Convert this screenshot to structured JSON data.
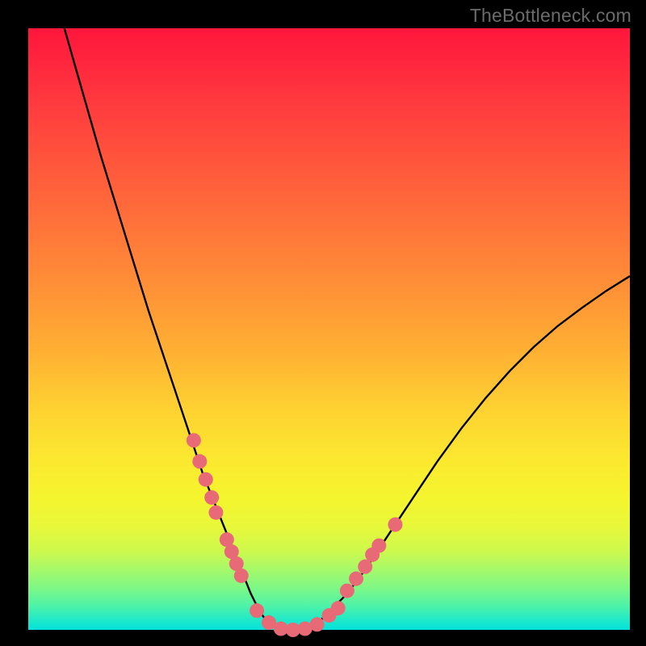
{
  "watermark": "TheBottleneck.com",
  "colors": {
    "curve_stroke": "#000000",
    "dot_fill": "#e76a76",
    "dot_stroke": "#c95560",
    "frame_bg": "#000000"
  },
  "chart_data": {
    "type": "line",
    "title": "",
    "xlabel": "",
    "ylabel": "",
    "xlim": [
      0,
      100
    ],
    "ylim": [
      0,
      100
    ],
    "grid": false,
    "series": [
      {
        "name": "bottleneck-curve",
        "x": [
          6,
          8,
          10,
          12,
          14,
          16,
          18,
          20,
          22,
          24,
          26,
          27,
          28,
          29,
          30,
          31,
          32,
          33,
          34,
          35,
          36,
          37,
          38,
          39,
          40,
          42,
          44,
          46,
          48,
          50,
          53,
          56,
          60,
          64,
          68,
          72,
          76,
          80,
          84,
          88,
          92,
          96,
          100
        ],
        "y": [
          100,
          93,
          86,
          79,
          72.5,
          66,
          59.5,
          53,
          47,
          41,
          35,
          32,
          29,
          26,
          23.5,
          21,
          18.5,
          16,
          13.5,
          11,
          8.5,
          6,
          4,
          2.3,
          1,
          0.1,
          0.0,
          0.2,
          1,
          3,
          6,
          10,
          16,
          22,
          28,
          33.5,
          38.5,
          43,
          47,
          50.5,
          53.5,
          56.3,
          58.8
        ]
      }
    ],
    "dots": {
      "name": "highlighted-points",
      "left_cluster_x": [
        27.5,
        28.5,
        29.5,
        30.5,
        31.2,
        33.0,
        33.8,
        34.6,
        35.4
      ],
      "left_cluster_y": [
        31.5,
        28.0,
        25.0,
        22.0,
        19.5,
        15.0,
        13.0,
        11.0,
        9.0
      ],
      "valley_x": [
        38.0,
        40.0,
        42.0,
        44.0,
        46.0,
        48.0,
        50.0,
        51.5
      ],
      "valley_y": [
        3.2,
        1.2,
        0.2,
        0.0,
        0.2,
        0.9,
        2.4,
        3.6
      ],
      "right_cluster_x": [
        53.0,
        54.5,
        56.0,
        57.2,
        58.3,
        61.0
      ],
      "right_cluster_y": [
        6.5,
        8.5,
        10.5,
        12.5,
        14.0,
        17.5
      ]
    }
  }
}
